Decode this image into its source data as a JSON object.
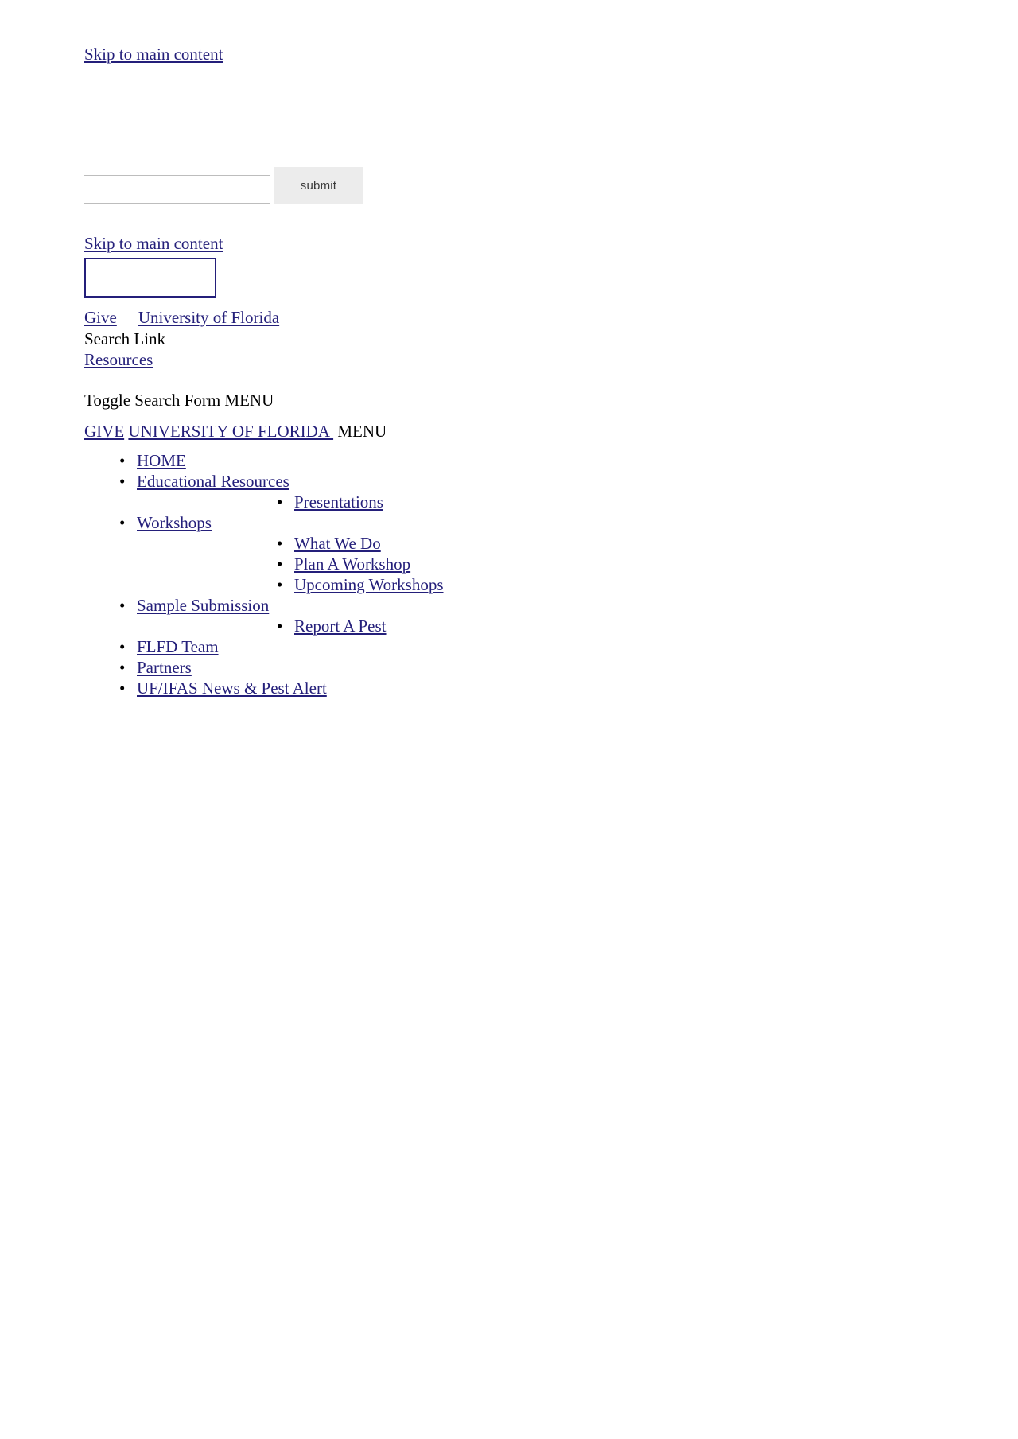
{
  "skip_links": {
    "top": "Skip to main content",
    "second": "Skip to main content"
  },
  "search": {
    "value": "",
    "placeholder": "",
    "submit_label": "submit"
  },
  "utility": {
    "give_label": "Give",
    "uf_label": "University of Florida",
    "search_link_label": "Search Link",
    "resources_label": "Resources "
  },
  "toggles": {
    "toggle_search_form": "Toggle Search Form",
    "menu_label_1": "MENU",
    "give_caps": "GIVE",
    "uf_caps": "UNIVERSITY OF FLORIDA ",
    "menu_label_2": "MENU"
  },
  "bullet_glyph": "•",
  "nav": {
    "items": [
      {
        "label": "HOME",
        "children": []
      },
      {
        "label": "Educational Resources ",
        "children": [
          {
            "label": "Presentations"
          }
        ]
      },
      {
        "label": "Workshops ",
        "children": [
          {
            "label": "What We Do"
          },
          {
            "label": "Plan A Workshop"
          },
          {
            "label": "Upcoming Workshops"
          }
        ]
      },
      {
        "label": "Sample Submission",
        "children": [
          {
            "label": "Report A Pest"
          }
        ]
      },
      {
        "label": "FLFD Team",
        "children": []
      },
      {
        "label": "Partners",
        "children": []
      },
      {
        "label": "UF/IFAS News & Pest Alert",
        "children": []
      }
    ]
  },
  "colors": {
    "link": "#241f7a",
    "text": "#000000",
    "button_bg": "#ececec",
    "input_border": "#bdbdbd",
    "logo_border": "#241f7a"
  }
}
